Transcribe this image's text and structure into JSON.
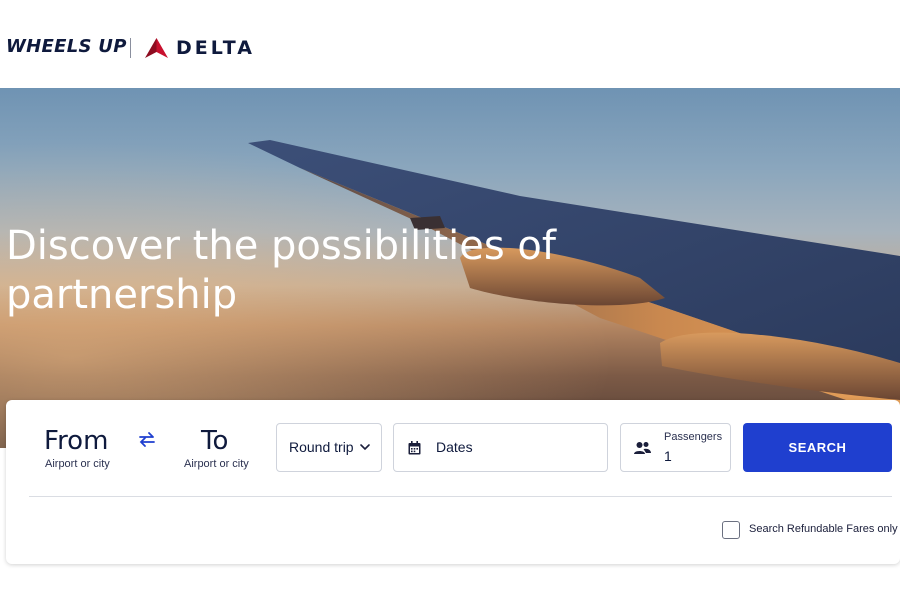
{
  "header": {
    "brand_primary": "WHEELS UP",
    "brand_partner": "DELTA",
    "colors": {
      "navy": "#0f1a3d",
      "delta_red": "#c8102e"
    }
  },
  "hero": {
    "title": "Discover the possibilities of partnership"
  },
  "search": {
    "from_title": "From",
    "from_sub": "Airport or city",
    "to_title": "To",
    "to_sub": "Airport or city",
    "swap_icon": "swap-arrows-icon",
    "trip_type": "Round trip",
    "dates_label": "Dates",
    "passengers_label": "Passengers",
    "passengers_count": "1",
    "search_button": "SEARCH",
    "refundable_label": "Search Refundable Fares only",
    "refundable_checked": false,
    "accent_color": "#1f3fcf"
  }
}
